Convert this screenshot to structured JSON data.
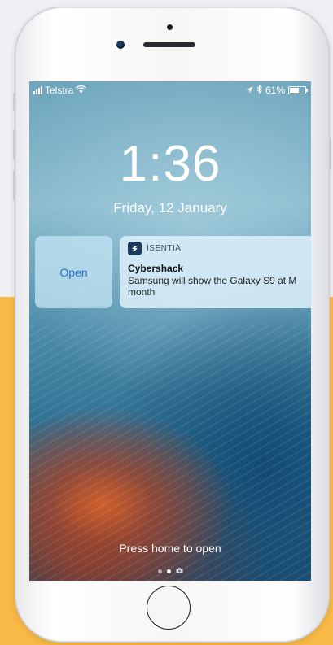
{
  "status_bar": {
    "carrier": "Telstra",
    "battery_text": "61%",
    "battery_level": 0.61,
    "icons": [
      "signal-icon",
      "wifi-icon",
      "location-arrow-icon",
      "bluetooth-icon",
      "battery-icon"
    ]
  },
  "lock_screen": {
    "time": "1:36",
    "date": "Friday, 12 January"
  },
  "notification": {
    "action_label": "Open",
    "app_name": "ISENTIA",
    "title": "Cybershack",
    "body": "Samsung will show the Galaxy S9 at M",
    "body_continued": "month"
  },
  "hint": "Press home to open",
  "pager": {
    "pages": 2,
    "active_index": 1,
    "extra": "camera-icon"
  },
  "colors": {
    "orange_panel": "#f9b946",
    "open_text": "#2b6fd0"
  }
}
